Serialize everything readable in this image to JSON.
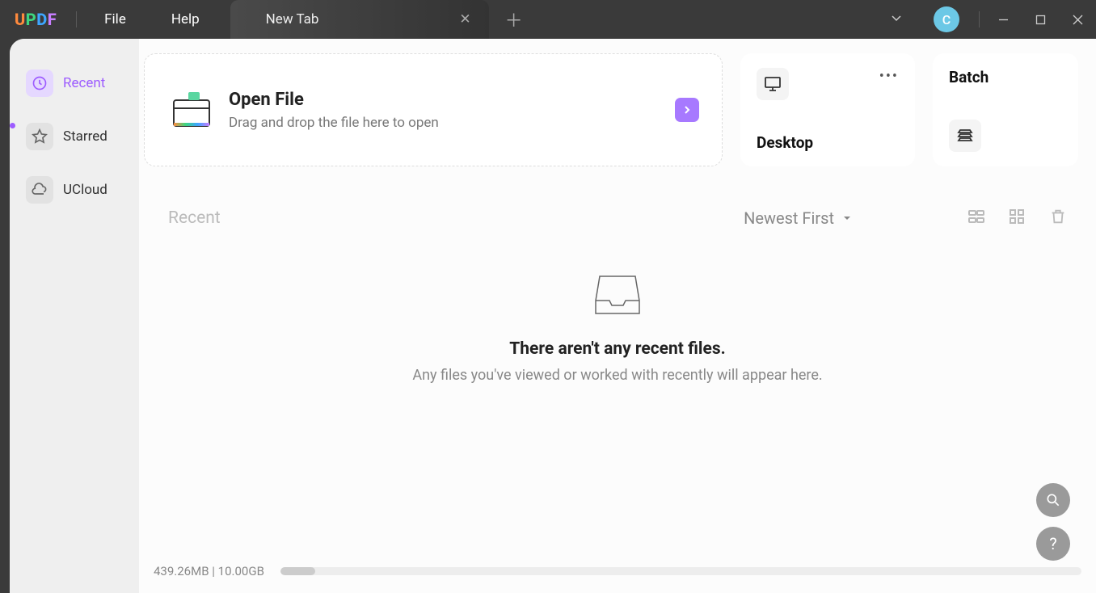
{
  "app": {
    "logo": "UPDF"
  },
  "menubar": {
    "file": "File",
    "help": "Help"
  },
  "tab": {
    "label": "New Tab"
  },
  "avatar": {
    "initial": "C"
  },
  "sidebar": {
    "items": [
      {
        "label": "Recent"
      },
      {
        "label": "Starred"
      },
      {
        "label": "UCloud"
      }
    ]
  },
  "open_file": {
    "title": "Open File",
    "subtitle": "Drag and drop the file here to open"
  },
  "cards": {
    "desktop": {
      "title": "Desktop"
    },
    "batch": {
      "title": "Batch"
    }
  },
  "recent_section": {
    "title": "Recent",
    "sort": "Newest First"
  },
  "empty_state": {
    "title": "There aren't any recent files.",
    "subtitle": "Any files you've viewed or worked with recently will appear here."
  },
  "storage": {
    "used": "439.26MB",
    "total": "10.00GB",
    "separator": " | "
  }
}
